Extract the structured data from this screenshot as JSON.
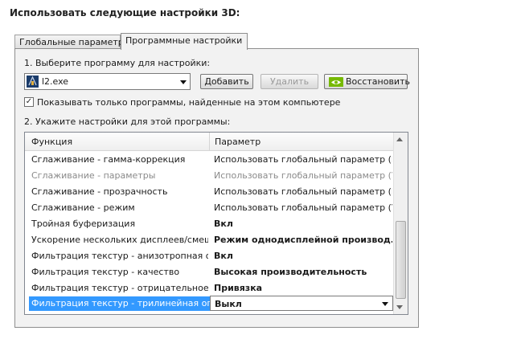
{
  "heading": "Использовать следующие настройки 3D:",
  "tabs": [
    {
      "label": "Глобальные параметры",
      "active": false
    },
    {
      "label": "Программные настройки",
      "active": true
    }
  ],
  "program_section": {
    "label": "1. Выберите программу для настройки:",
    "selected_program": "l2.exe",
    "buttons": {
      "add": "Добавить",
      "delete": "Удалить",
      "restore": "Восстановить"
    },
    "show_only_checkbox": {
      "checked": true,
      "label": "Показывать только программы, найденные на этом компьютере"
    }
  },
  "settings_section": {
    "label": "2. Укажите настройки для этой программы:",
    "columns": [
      "Функция",
      "Параметр"
    ],
    "rows": [
      {
        "function": "Сглаживание - гамма-коррекция",
        "param": "Использовать глобальный параметр (Вкл)",
        "state": "normal"
      },
      {
        "function": "Сглаживание - параметры",
        "param": "Использовать глобальный параметр (У...",
        "state": "disabled"
      },
      {
        "function": "Сглаживание - прозрачность",
        "param": "Использовать глобальный параметр (В...",
        "state": "normal"
      },
      {
        "function": "Сглаживание - режим",
        "param": "Использовать глобальный параметр (У...",
        "state": "normal"
      },
      {
        "function": "Тройная буферизация",
        "param": "Вкл",
        "state": "bold"
      },
      {
        "function": "Ускорение нескольких дисплеев/смеша...",
        "param": "Режим однодисплейной производ...",
        "state": "bold"
      },
      {
        "function": "Фильтрация текстур - анизотропная опт...",
        "param": "Вкл",
        "state": "bold"
      },
      {
        "function": "Фильтрация текстур - качество",
        "param": "Высокая производительность",
        "state": "bold"
      },
      {
        "function": "Фильтрация текстур - отрицательное о...",
        "param": "Привязка",
        "state": "bold"
      },
      {
        "function": "Фильтрация текстур - трилинейная опт...",
        "param": "Выкл",
        "state": "selected"
      }
    ]
  },
  "colors": {
    "selection": "#3399ff",
    "nvidia_green": "#76b900",
    "panel_bg": "#f2f2f2"
  }
}
